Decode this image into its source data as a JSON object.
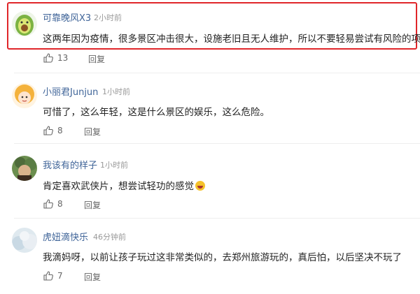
{
  "comments": [
    {
      "username": "可靠晚风X3",
      "time": "2小时前",
      "text": "这两年因为疫情，很多景区冲击很大，设施老旧且无人维护，所以不要轻易尝试有风险的项目",
      "likes": "13",
      "reply_label": "回复",
      "avatar": "avocado-avatar"
    },
    {
      "username": "小丽君Junjun",
      "time": "1小时前",
      "text": "可惜了，这么年轻，这是什么景区的娱乐，这么危险。",
      "likes": "8",
      "reply_label": "回复",
      "avatar": "cartoon-girl-avatar"
    },
    {
      "username": "我该有的样子",
      "time": "1小时前",
      "text": "肯定喜欢武侠片，想尝试轻功的感觉",
      "likes": "8",
      "reply_label": "回复",
      "avatar": "photo-avatar",
      "emoji": "laughing-emoji"
    },
    {
      "username": "虎妞滴快乐",
      "time": "46分钟前",
      "text": "我滴妈呀，以前让孩子玩过这非常类似的，去郑州旅游玩的，真后怕，以后坚决不玩了",
      "likes": "7",
      "reply_label": "回复",
      "avatar": "cloud-avatar"
    }
  ],
  "colors": {
    "username": "#406599",
    "highlight_border": "#e0262a"
  }
}
